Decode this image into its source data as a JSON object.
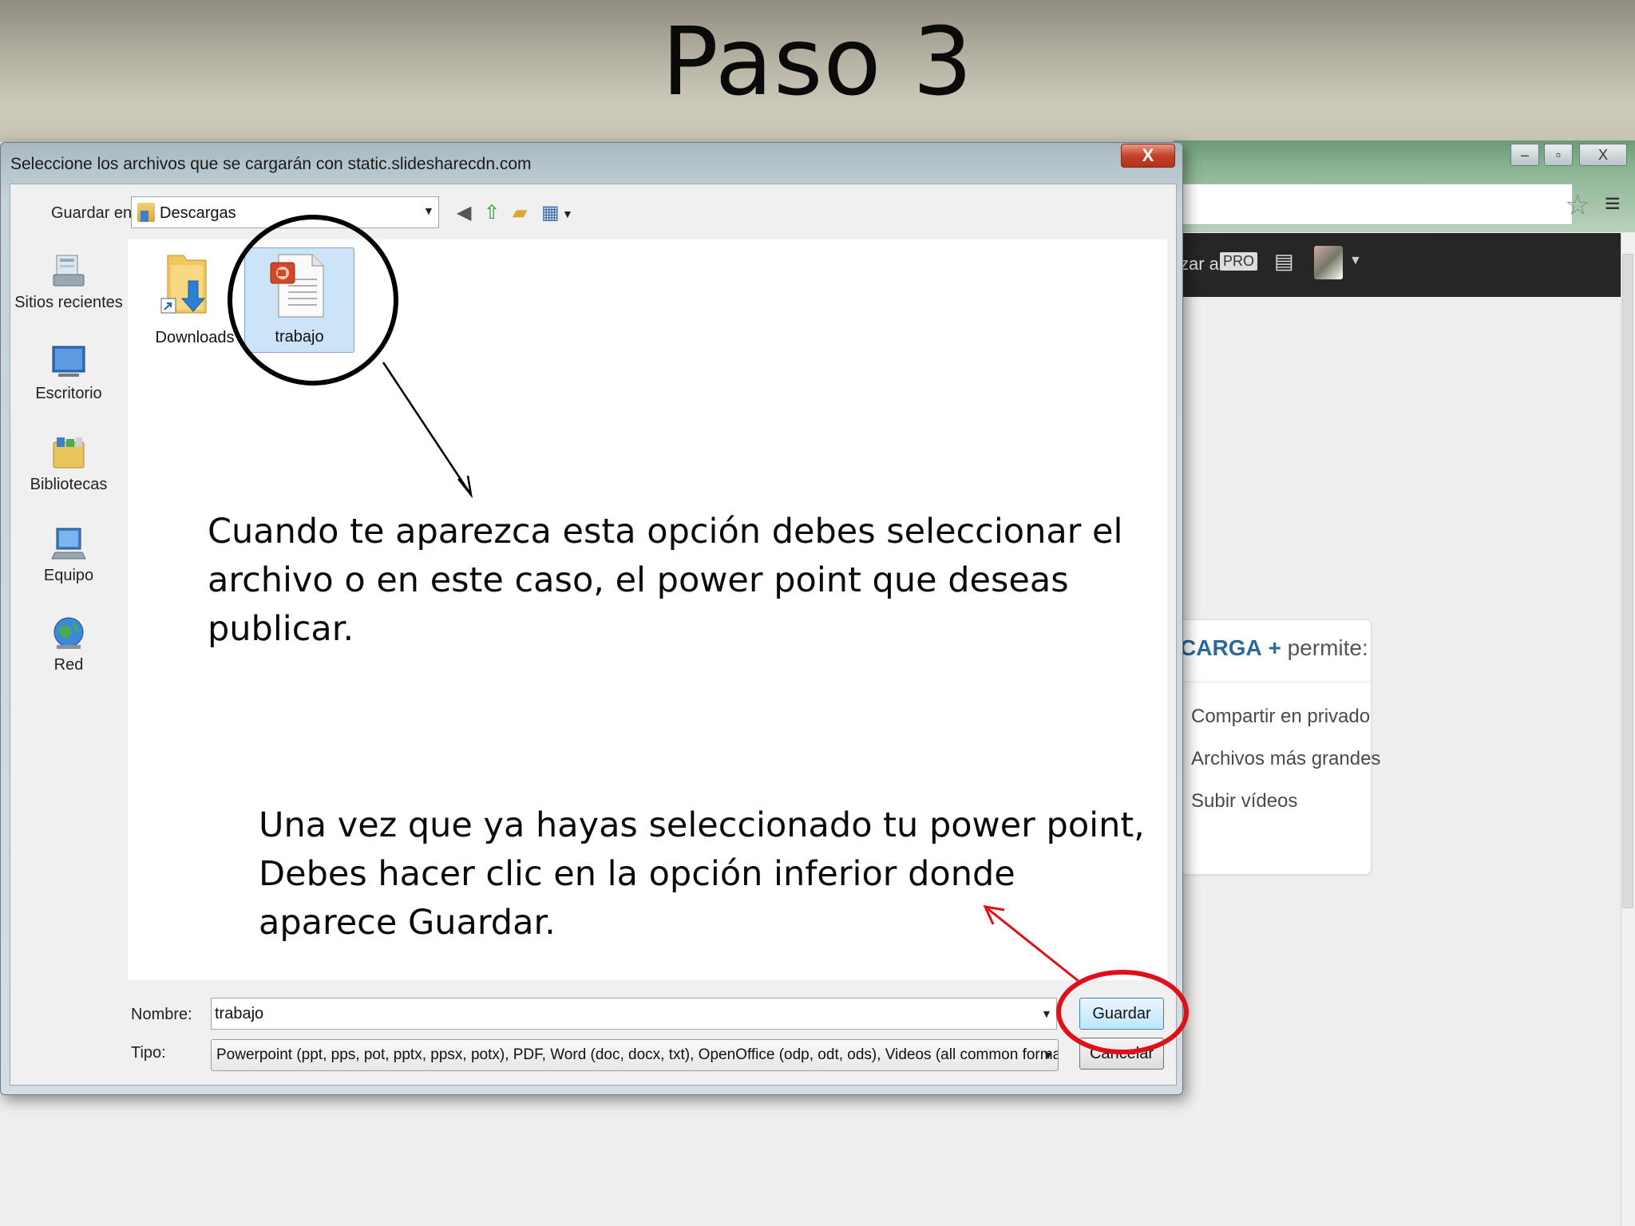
{
  "slide": {
    "title": "Paso 3"
  },
  "browser": {
    "window_buttons": [
      "–",
      "▫",
      "X"
    ],
    "pro_prefix": "zar a",
    "pro_badge": "PRO",
    "upload_card": {
      "title_brand": "CARGA",
      "title_plus": "+",
      "title_suffix": "permite:",
      "features": [
        "Compartir en privado",
        "Archivos más grandes",
        "Subir vídeos"
      ]
    }
  },
  "dialog": {
    "title": "Seleccione los archivos que se cargarán con static.slidesharecdn.com",
    "close_label": "X",
    "save_in_label": "Guardar en:",
    "save_in_value": "Descargas",
    "places": [
      "Sitios recientes",
      "Escritorio",
      "Bibliotecas",
      "Equipo",
      "Red"
    ],
    "files": [
      {
        "label": "Downloads"
      },
      {
        "label": "trabajo"
      }
    ],
    "name_label": "Nombre:",
    "name_value": "trabajo",
    "type_label": "Tipo:",
    "type_value": "Powerpoint (ppt, pps, pot, pptx, ppsx, potx), PDF, Word (doc, docx, txt), OpenOffice (odp, odt, ods), Videos (all common formats)",
    "save_button": "Guardar",
    "cancel_button": "Cancelar"
  },
  "annotations": {
    "callout_1": "Cuando te aparezca esta opción debes seleccionar el archivo o en este caso, el power point que deseas publicar.",
    "callout_2": "Una vez que ya hayas seleccionado tu power point, Debes hacer clic en la opción inferior donde aparece Guardar."
  },
  "colors": {
    "highlight_circle_black": "#000000",
    "highlight_circle_red": "#e0101a",
    "close_button": "#c6412b"
  }
}
